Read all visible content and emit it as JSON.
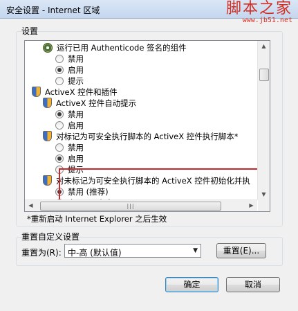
{
  "window": {
    "title": "安全设置 - Internet 区域"
  },
  "watermark": {
    "main": "脚本之家",
    "sub": "www.jb51.net"
  },
  "settings": {
    "group_label": "设置",
    "rows": [
      {
        "kind": "gear",
        "text": "运行已用 Authenticode 签名的组件"
      },
      {
        "kind": "radio",
        "text": "禁用",
        "checked": false
      },
      {
        "kind": "radio",
        "text": "启用",
        "checked": true
      },
      {
        "kind": "radio",
        "text": "提示",
        "checked": false
      },
      {
        "kind": "shield",
        "text": "ActiveX 控件和插件"
      },
      {
        "kind": "shield",
        "text": "ActiveX 控件自动提示"
      },
      {
        "kind": "radio",
        "text": "禁用",
        "checked": true
      },
      {
        "kind": "radio",
        "text": "启用",
        "checked": false
      },
      {
        "kind": "shield",
        "text": "对标记为可安全执行脚本的 ActiveX 控件执行脚本*"
      },
      {
        "kind": "radio",
        "text": "禁用",
        "checked": false
      },
      {
        "kind": "radio",
        "text": "启用",
        "checked": true
      },
      {
        "kind": "radio",
        "text": "提示",
        "checked": false
      },
      {
        "kind": "shield",
        "text": "对未标记为可安全执行脚本的 ActiveX 控件初始化并执"
      },
      {
        "kind": "radio",
        "text": "禁用 (推荐)",
        "checked": true
      },
      {
        "kind": "radio",
        "text": "启用 (不安全)",
        "checked": false
      }
    ],
    "note": "*重新启动 Internet Explorer 之后生效"
  },
  "reset": {
    "group_label": "重置自定义设置",
    "reset_to_label": "重置为(R):",
    "combo_value": "中-高 (默认值)",
    "reset_button": "重置(E)..."
  },
  "buttons": {
    "ok": "确定",
    "cancel": "取消"
  }
}
